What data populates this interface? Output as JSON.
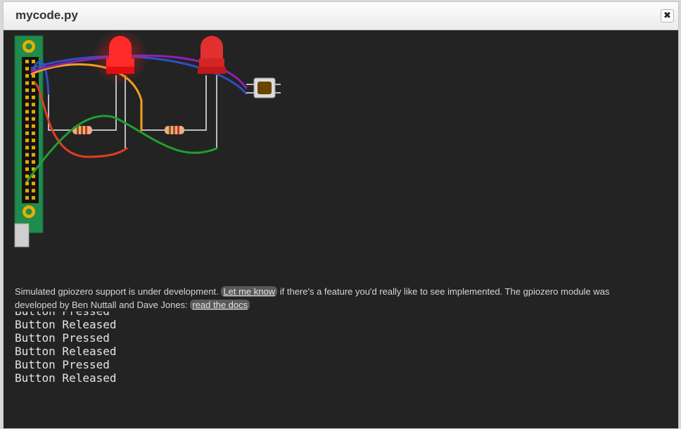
{
  "window": {
    "title": "mycode.py",
    "close_label": "✖"
  },
  "circuit": {
    "led1_state": "on",
    "led2_state": "off",
    "led_color": "#ff2a2a",
    "board_color": "#1f8b4c",
    "wire_colors": [
      "#3050c0",
      "#f0a020",
      "#9020b0",
      "#d84020",
      "#20a030"
    ],
    "button_icon": "push-button-icon"
  },
  "notice": {
    "text_before": "Simulated gpiozero support is under development.",
    "link1": "Let me know",
    "text_middle": "if there's a feature you'd really like to see implemented. The gpiozero module was developed by Ben Nuttall and Dave Jones:",
    "link2": "read the docs"
  },
  "output": {
    "partial_line": "Button Pressed",
    "lines": [
      "Button Released",
      "Button Pressed",
      "Button Released",
      "Button Pressed",
      "Button Released"
    ]
  }
}
